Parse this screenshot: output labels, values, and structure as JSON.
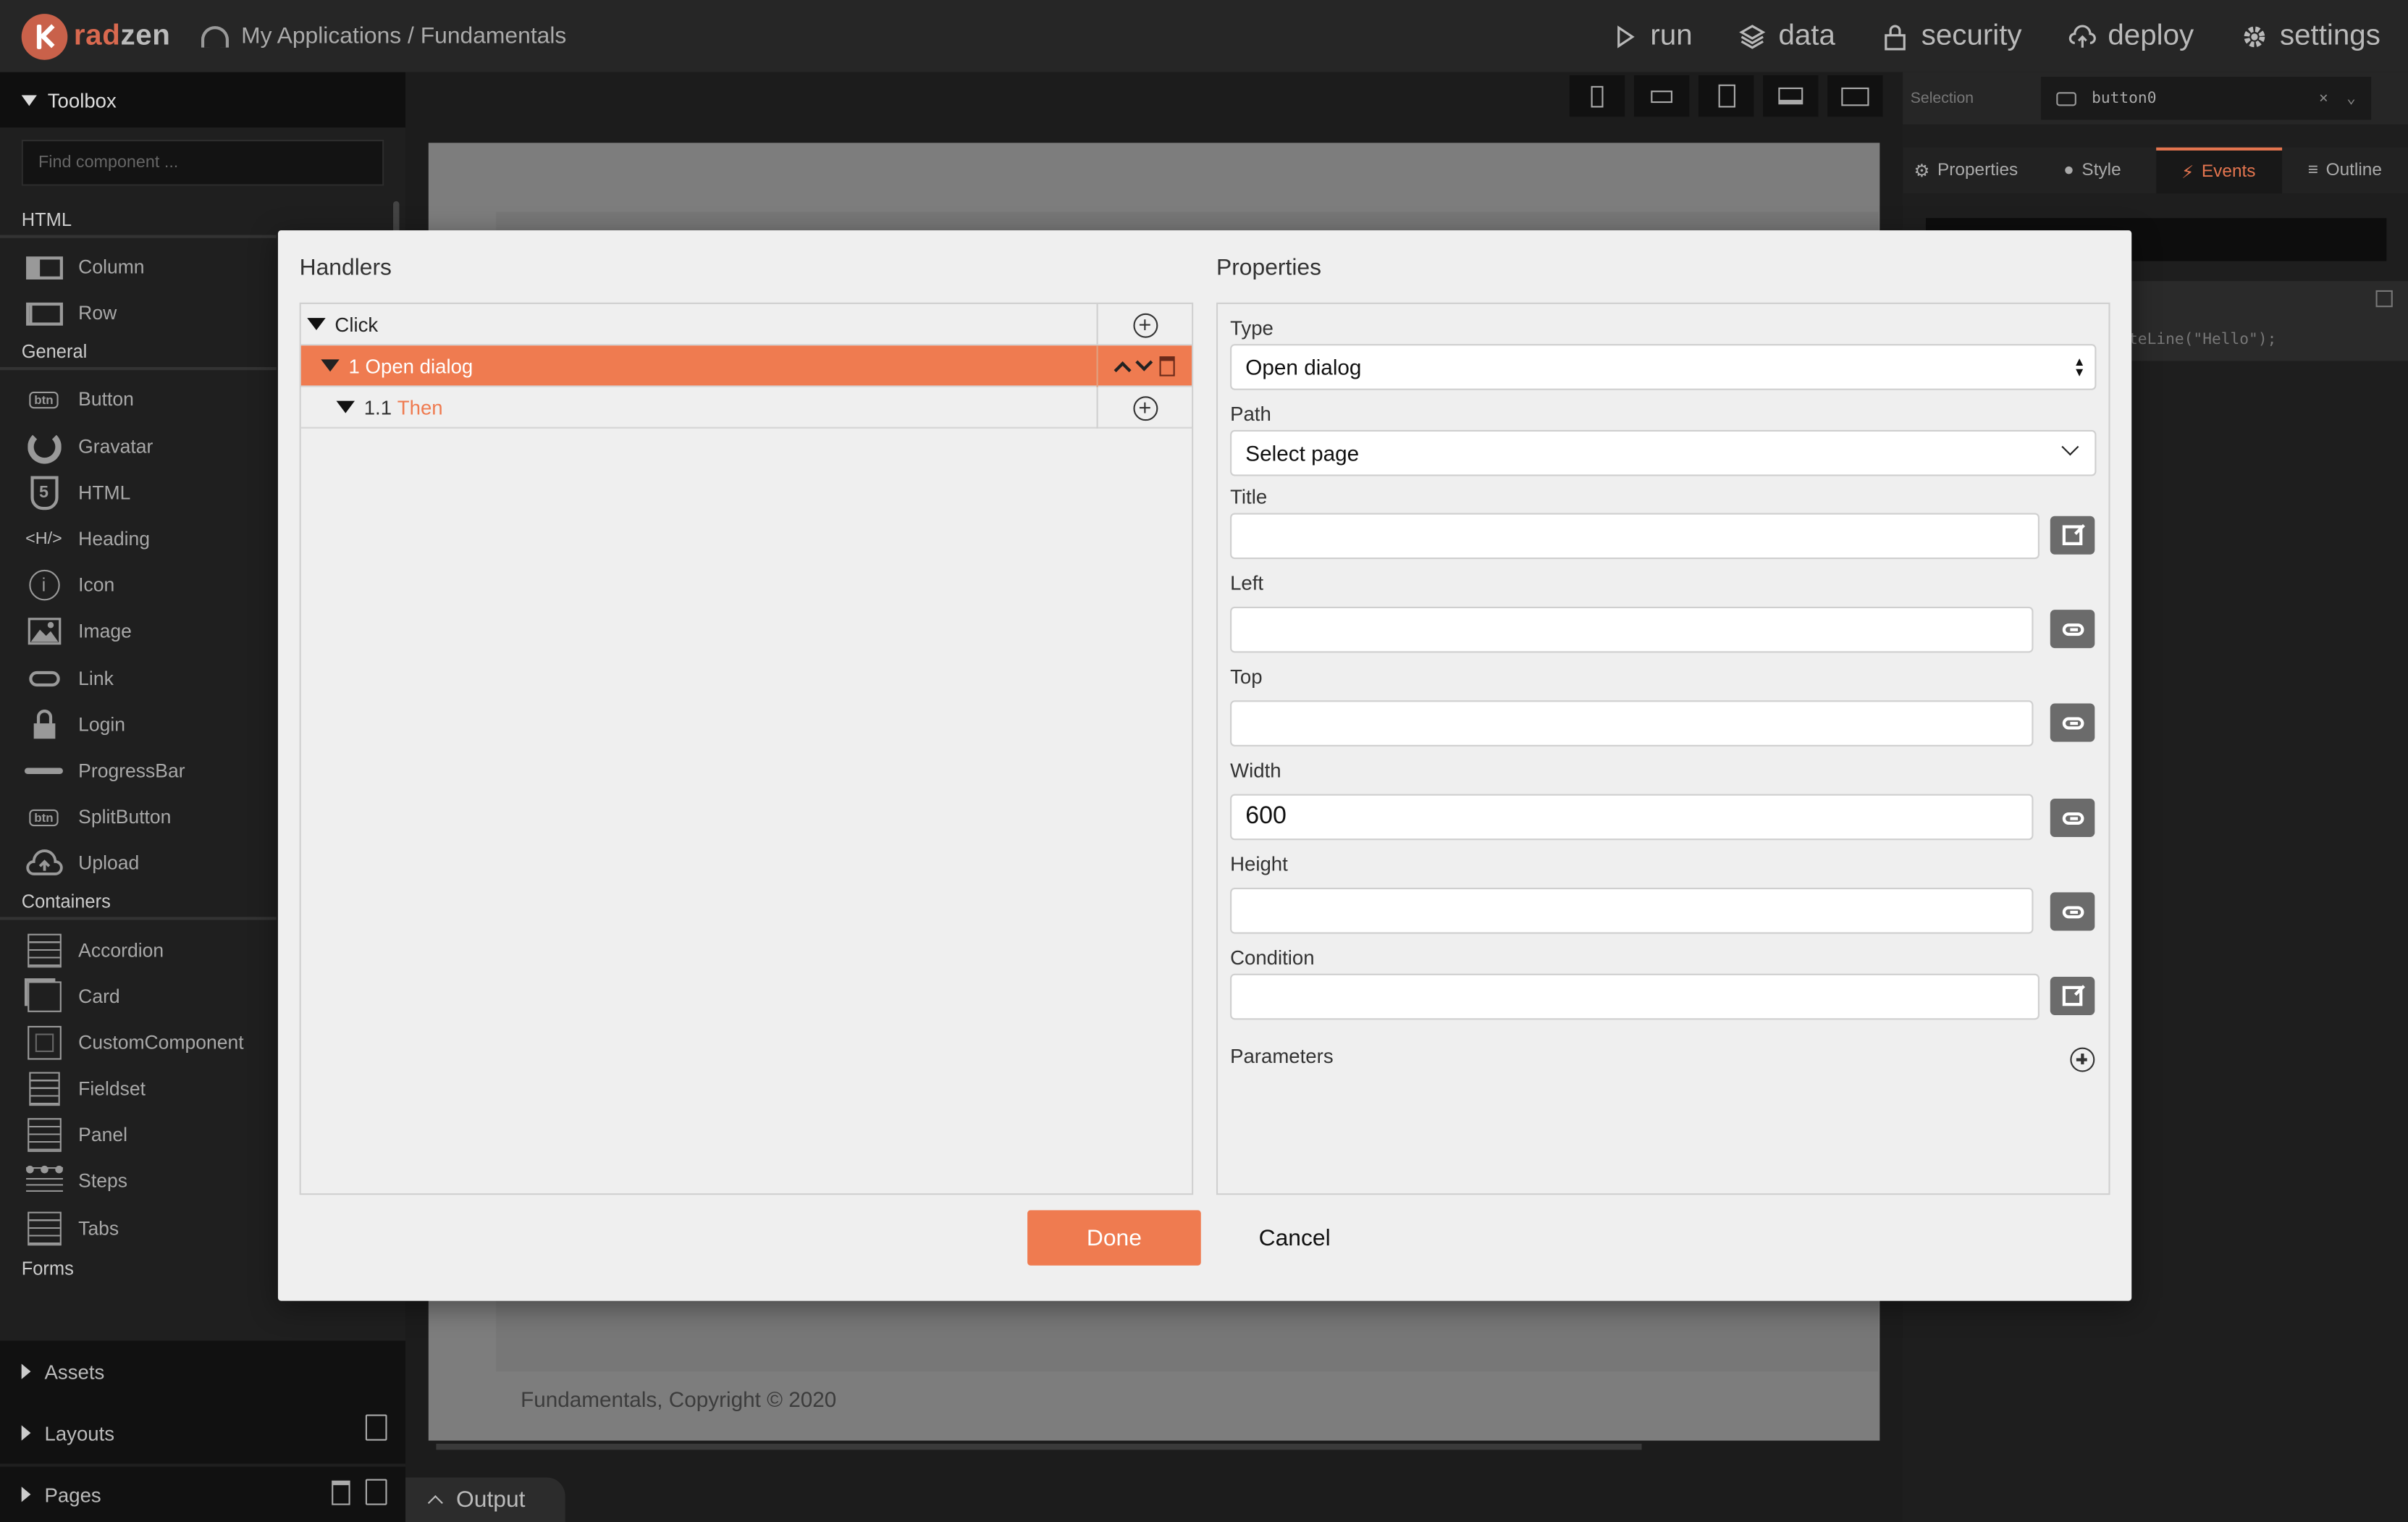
{
  "header": {
    "logo_rad": "rad",
    "logo_zen": "zen",
    "breadcrumb": "My Applications / Fundamentals",
    "nav": [
      "run",
      "data",
      "security",
      "deploy",
      "settings"
    ]
  },
  "toolbox": {
    "title": "Toolbox",
    "search_placeholder": "Find component ...",
    "categories": {
      "html": "HTML",
      "general": "General",
      "containers": "Containers",
      "forms": "Forms"
    },
    "html_items": [
      "Column",
      "Row"
    ],
    "general_items": [
      "Button",
      "Gravatar",
      "HTML",
      "Heading",
      "Icon",
      "Image",
      "Link",
      "Login",
      "ProgressBar",
      "SplitButton",
      "Upload"
    ],
    "container_items": [
      "Accordion",
      "Card",
      "CustomComponent",
      "Fieldset",
      "Panel",
      "Steps",
      "Tabs"
    ],
    "bottom": [
      "Assets",
      "Layouts",
      "Pages"
    ],
    "heading_icon_text": "<H/>",
    "btn_icon_text": "btn"
  },
  "canvas": {
    "footer": "Fundamentals, Copyright © 2020",
    "output_label": "Output"
  },
  "inspector": {
    "selection_label": "Selection",
    "selection_value": "button0",
    "tabs": [
      "Properties",
      "Style",
      "Events",
      "Outline"
    ],
    "code_snippet": "iteLine(\"Hello\");"
  },
  "dialog": {
    "handlers_title": "Handlers",
    "properties_title": "Properties",
    "handlers": {
      "event": "Click",
      "action_number": "1",
      "action": "Open dialog",
      "then_number": "1.1",
      "then_label": "Then"
    },
    "fields": {
      "type_label": "Type",
      "type_value": "Open dialog",
      "path_label": "Path",
      "path_value": "Select page",
      "title_label": "Title",
      "left_label": "Left",
      "top_label": "Top",
      "width_label": "Width",
      "width_value": "600",
      "height_label": "Height",
      "condition_label": "Condition",
      "parameters_label": "Parameters"
    },
    "done_label": "Done",
    "cancel_label": "Cancel"
  },
  "colors": {
    "accent": "#ef7b50",
    "brand": "#d9694f"
  }
}
